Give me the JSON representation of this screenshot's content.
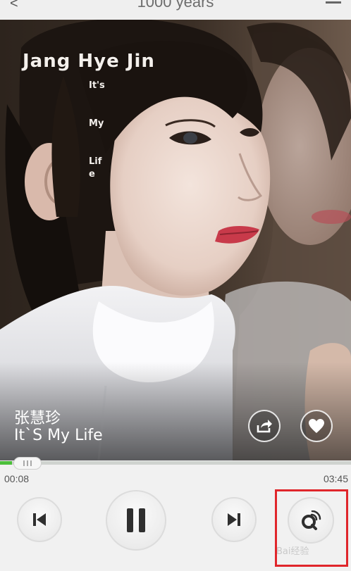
{
  "header": {
    "title": "1000 years",
    "back_glyph": "<",
    "menu_icon": "menu-icon"
  },
  "album_art": {
    "logo_text": "Jang Hye Jin",
    "vertical_words": [
      "It's",
      "My",
      "Lif",
      "e"
    ]
  },
  "track": {
    "artist": "张慧珍",
    "title": "It`S My Life"
  },
  "progress": {
    "elapsed": "00:08",
    "duration": "03:45",
    "fraction": 0.035
  },
  "actions": {
    "share_icon": "share-icon",
    "favorite_icon": "heart-icon"
  },
  "controls": {
    "prev_icon": "previous-icon",
    "play_pause_icon": "pause-icon",
    "next_icon": "next-icon",
    "mode_icon": "play-mode-icon"
  },
  "annotation": {
    "color": "#e0262b"
  },
  "colors": {
    "accent": "#4cbf3a"
  }
}
